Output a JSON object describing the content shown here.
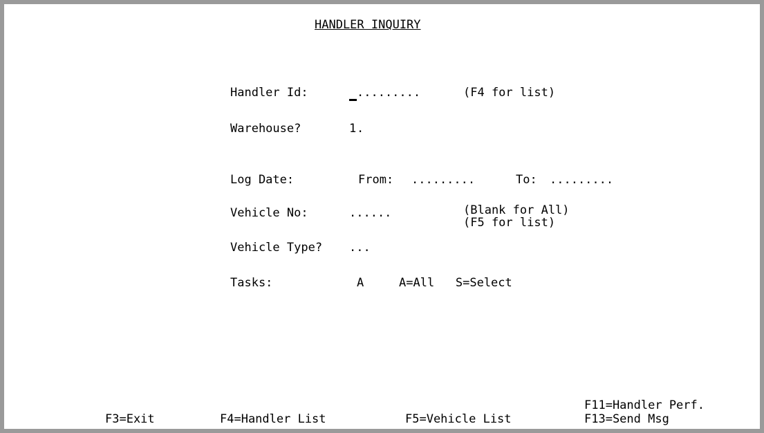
{
  "title": "HANDLER INQUIRY",
  "fields": {
    "handler_id": {
      "label": "Handler Id:",
      "value": "",
      "placeholder": ".........",
      "hint": "(F4 for list)"
    },
    "warehouse": {
      "label": "Warehouse?",
      "value": "1",
      "placeholder": "."
    },
    "log_date": {
      "label": "Log Date:",
      "from_label": "From:",
      "from_placeholder": ".........",
      "to_label": "To:",
      "to_placeholder": "........."
    },
    "vehicle_no": {
      "label": "Vehicle No:",
      "placeholder": "......",
      "hint_line1": "(Blank for All)",
      "hint_line2": "(F5 for list)"
    },
    "vehicle_type": {
      "label": "Vehicle Type?",
      "placeholder": "..."
    },
    "tasks": {
      "label": "Tasks:",
      "value": "A",
      "options": "A=All   S=Select"
    }
  },
  "function_keys": {
    "f3": "F3=Exit",
    "f4": "F4=Handler List",
    "f5": "F5=Vehicle List",
    "f11": "F11=Handler Perf.",
    "f13": "F13=Send Msg"
  }
}
